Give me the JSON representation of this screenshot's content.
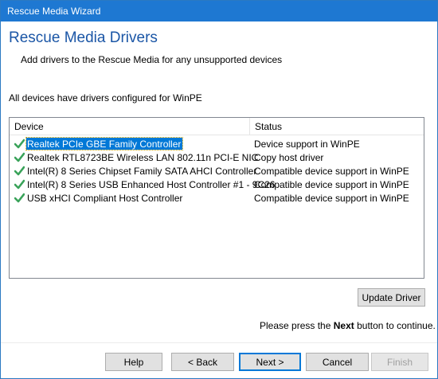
{
  "window": {
    "title": "Rescue Media Wizard"
  },
  "page": {
    "heading": "Rescue Media Drivers",
    "subheading": "Add drivers to the Rescue Media for any unsupported devices",
    "info": "All devices have drivers configured for WinPE"
  },
  "list": {
    "columns": [
      "Device",
      "Status"
    ],
    "rows": [
      {
        "device": "Realtek PCIe GBE Family Controller",
        "status": "Device support in WinPE",
        "selected": true,
        "icon": "green-check-icon"
      },
      {
        "device": "Realtek RTL8723BE Wireless LAN 802.11n PCI-E NIC",
        "status": "Copy host driver",
        "selected": false,
        "icon": "green-check-icon"
      },
      {
        "device": "Intel(R) 8 Series Chipset Family SATA AHCI Controller",
        "status": "Compatible device support in WinPE",
        "selected": false,
        "icon": "green-check-icon"
      },
      {
        "device": "Intel(R) 8 Series USB Enhanced Host Controller #1 - 9C26",
        "status": "Compatible device support in WinPE",
        "selected": false,
        "icon": "green-check-icon"
      },
      {
        "device": "USB xHCI Compliant Host Controller",
        "status": "Compatible device support in WinPE",
        "selected": false,
        "icon": "green-check-icon"
      }
    ]
  },
  "buttons": {
    "update_driver": "Update Driver",
    "help": "Help",
    "back": "< Back",
    "next": "Next >",
    "cancel": "Cancel",
    "finish": "Finish"
  },
  "hint": {
    "before": "Please press the",
    "bold": "Next",
    "after": "button to continue."
  },
  "colors": {
    "titlebar": "#1e78d2",
    "heading": "#1b56a6",
    "selection": "#0078d7",
    "check": "#3aa35a"
  }
}
